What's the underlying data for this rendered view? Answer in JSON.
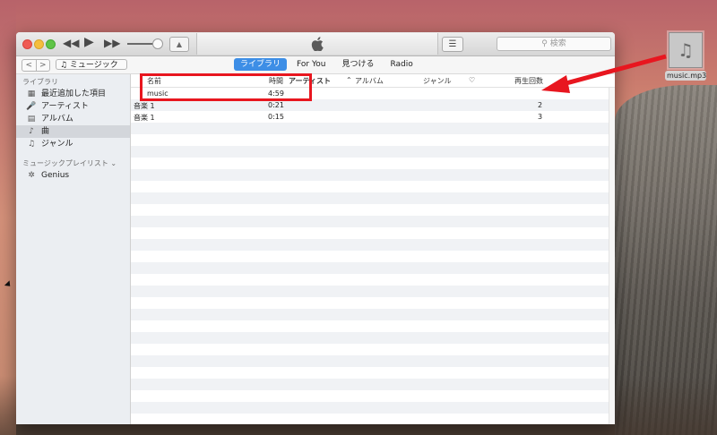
{
  "desktop": {
    "file_name": "music.mp3",
    "file_icon": "music-note-icon"
  },
  "toolbar": {
    "search_placeholder": "検索",
    "apple_icon": "apple-logo-icon",
    "airplay_icon": "airplay-icon",
    "list_icon": "list-icon"
  },
  "navbar": {
    "back": "<",
    "forward": ">",
    "source_label": "♫ ミュージック",
    "tabs": [
      {
        "label": "ライブラリ",
        "active": true
      },
      {
        "label": "For You"
      },
      {
        "label": "見つける"
      },
      {
        "label": "Radio"
      }
    ]
  },
  "sidebar": {
    "library_header": "ライブラリ",
    "items": [
      {
        "label": "最近追加した項目",
        "icon": "calendar-icon"
      },
      {
        "label": "アーティスト",
        "icon": "microphone-icon"
      },
      {
        "label": "アルバム",
        "icon": "album-icon"
      },
      {
        "label": "曲",
        "icon": "music-note-icon",
        "selected": true
      },
      {
        "label": "ジャンル",
        "icon": "genre-icon"
      }
    ],
    "playlists_header": "ミュージックプレイリスト",
    "playlists": [
      {
        "label": "Genius",
        "icon": "genius-icon"
      }
    ]
  },
  "table": {
    "columns": [
      "名前",
      "時間",
      "アーティスト",
      "アルバム",
      "ジャンル",
      "♡",
      "再生回数"
    ],
    "rows": [
      {
        "name": "music",
        "time": "4:59",
        "plays": ""
      },
      {
        "name": "音楽 1",
        "time": "0:21",
        "plays": "2"
      },
      {
        "name": "音楽 1",
        "time": "0:15",
        "plays": "3"
      }
    ]
  },
  "annotations": {
    "highlight_color": "#e8161f",
    "arrow_color": "#e8161f"
  }
}
